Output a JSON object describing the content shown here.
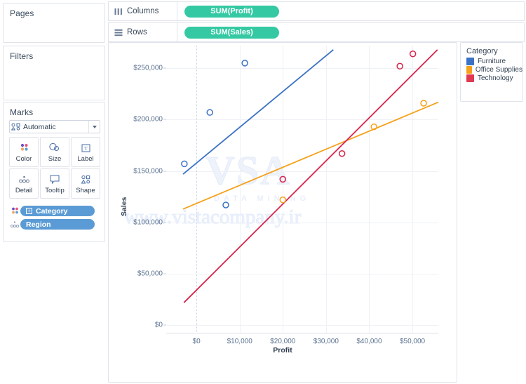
{
  "left_panel": {
    "pages": {
      "title": "Pages"
    },
    "filters": {
      "title": "Filters"
    },
    "marks": {
      "title": "Marks",
      "mark_type": "Automatic",
      "buttons": [
        {
          "label": "Color",
          "icon": "color-dots-icon"
        },
        {
          "label": "Size",
          "icon": "size-shapes-icon"
        },
        {
          "label": "Label",
          "icon": "label-text-icon"
        },
        {
          "label": "Detail",
          "icon": "detail-dots-icon"
        },
        {
          "label": "Tooltip",
          "icon": "tooltip-bubble-icon"
        },
        {
          "label": "Shape",
          "icon": "shape-glyphs-icon"
        }
      ],
      "pills": [
        {
          "label": "Category",
          "icon": "color-dots-icon",
          "has_expand": true
        },
        {
          "label": "Region",
          "icon": "detail-dots-icon",
          "has_expand": false
        }
      ]
    }
  },
  "shelves": [
    {
      "name": "columns",
      "label": "Columns",
      "icon": "columns-icon",
      "pill": "SUM(Profit)"
    },
    {
      "name": "rows",
      "label": "Rows",
      "icon": "rows-icon",
      "pill": "SUM(Sales)"
    }
  ],
  "legend": {
    "title": "Category",
    "items": [
      {
        "label": "Furniture",
        "color": "#3b72c4"
      },
      {
        "label": "Office Supplies",
        "color": "#f5a11a"
      },
      {
        "label": "Technology",
        "color": "#e03a52"
      }
    ]
  },
  "watermark": {
    "logo": "VSA",
    "subtitle": "DATA MINING",
    "url": "www.vistacompany.ir"
  },
  "colors": {
    "green_pill": "#34c9a3",
    "blue_pill": "#5b9bd5",
    "furniture": "#3b72c4",
    "office_supplies": "#f5a11a",
    "technology": "#d6234a",
    "grid": "#eef1f6",
    "axis_text": "#5b7290"
  },
  "chart_data": {
    "type": "scatter",
    "title": "",
    "xlabel": "Profit",
    "ylabel": "Sales",
    "xlim": [
      -7000,
      56000
    ],
    "ylim": [
      -8000,
      272000
    ],
    "xticks": [
      0,
      10000,
      20000,
      30000,
      40000,
      50000
    ],
    "xtick_labels": [
      "$0",
      "$10,000",
      "$20,000",
      "$30,000",
      "$40,000",
      "$50,000"
    ],
    "yticks": [
      0,
      50000,
      100000,
      150000,
      200000,
      250000
    ],
    "ytick_labels": [
      "$0",
      "$50,000",
      "$100,000",
      "$150,000",
      "$200,000",
      "$250,000"
    ],
    "grid": true,
    "legend_position": "right",
    "series": [
      {
        "name": "Furniture",
        "color": "#3b72c4",
        "points": [
          {
            "x": -2800,
            "y": 157000
          },
          {
            "x": 3100,
            "y": 207000
          },
          {
            "x": 11200,
            "y": 255000
          },
          {
            "x": 6800,
            "y": 117000
          }
        ],
        "trend_line": {
          "x1": -3100,
          "y1": 147000,
          "x2": 31700,
          "y2": 268000
        }
      },
      {
        "name": "Office Supplies",
        "color": "#f5a11a",
        "points": [
          {
            "x": 20000,
            "y": 122000
          },
          {
            "x": 41100,
            "y": 193000
          },
          {
            "x": 52600,
            "y": 216000
          }
        ],
        "trend_line": {
          "x1": -3100,
          "y1": 113000,
          "x2": 56000,
          "y2": 217000
        }
      },
      {
        "name": "Technology",
        "color": "#d6234a",
        "points": [
          {
            "x": 20000,
            "y": 142000
          },
          {
            "x": 33700,
            "y": 167000
          },
          {
            "x": 47100,
            "y": 252000
          },
          {
            "x": 50100,
            "y": 264000
          }
        ],
        "trend_line": {
          "x1": -2900,
          "y1": 22000,
          "x2": 55800,
          "y2": 268000
        }
      }
    ]
  }
}
